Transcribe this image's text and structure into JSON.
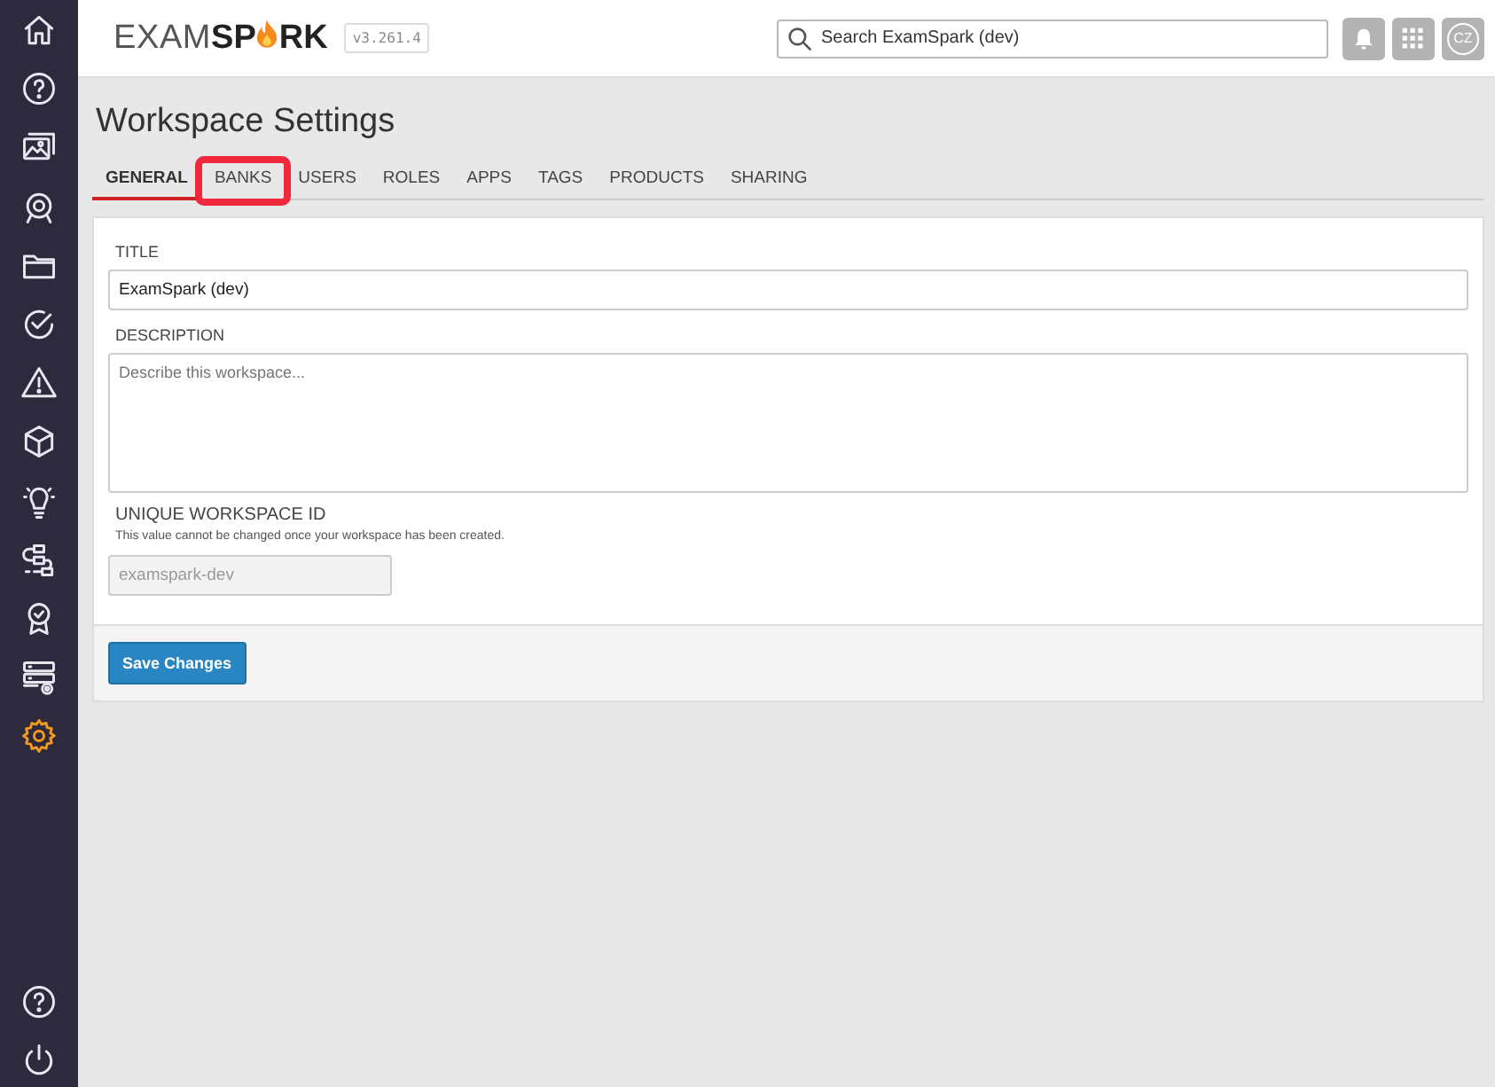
{
  "sidebar": {
    "items": [
      {
        "selected": false
      },
      {
        "selected": false
      },
      {
        "selected": false
      },
      {
        "selected": false
      },
      {
        "selected": false
      },
      {
        "selected": false
      },
      {
        "selected": false
      },
      {
        "selected": false
      },
      {
        "selected": false
      },
      {
        "selected": false
      },
      {
        "selected": false
      },
      {
        "selected": false
      },
      {
        "selected": true
      }
    ]
  },
  "header": {
    "logo": {
      "prefix": "EXAM",
      "accent_start": "SP",
      "accent_end": "RK"
    },
    "version": "v3.261.4",
    "search": {
      "placeholder": "Search ExamSpark (dev)"
    },
    "avatar": "CZ"
  },
  "page": {
    "title": "Workspace Settings",
    "tabs": [
      {
        "label": "GENERAL",
        "selected": true,
        "highlighted": false
      },
      {
        "label": "BANKS",
        "selected": false,
        "highlighted": true
      },
      {
        "label": "USERS",
        "selected": false,
        "highlighted": false
      },
      {
        "label": "ROLES",
        "selected": false,
        "highlighted": false
      },
      {
        "label": "APPS",
        "selected": false,
        "highlighted": false
      },
      {
        "label": "TAGS",
        "selected": false,
        "highlighted": false
      },
      {
        "label": "PRODUCTS",
        "selected": false,
        "highlighted": false
      },
      {
        "label": "SHARING",
        "selected": false,
        "highlighted": false
      }
    ],
    "form": {
      "title_label": "TITLE",
      "title_value": "ExamSpark (dev)",
      "description_label": "DESCRIPTION",
      "description_placeholder": "Describe this workspace...",
      "id_label": "UNIQUE WORKSPACE ID",
      "id_help": "This value cannot be changed once your workspace has been created.",
      "id_value": "examspark-dev",
      "save_button": "Save Changes"
    }
  }
}
